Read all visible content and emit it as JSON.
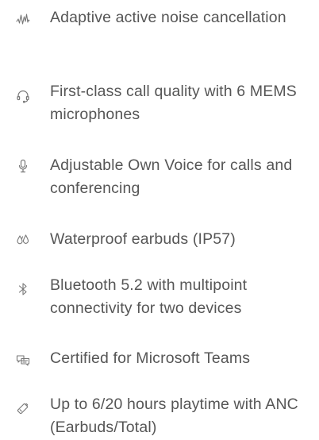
{
  "features": [
    {
      "icon": "noise-cancellation-waveform-icon",
      "text": "Adaptive active noise cancellation"
    },
    {
      "icon": "headset-icon",
      "text": "First-class call quality with 6 MEMS microphones"
    },
    {
      "icon": "microphone-icon",
      "text": "Adjustable Own Voice for calls and conferencing"
    },
    {
      "icon": "water-drops-icon",
      "text": "Waterproof earbuds (IP57)"
    },
    {
      "icon": "bluetooth-icon",
      "text": "Bluetooth 5.2 with multipoint connectivity for two devices"
    },
    {
      "icon": "chat-bubbles-icon",
      "text": "Certified for Microsoft Teams"
    },
    {
      "icon": "battery-icon",
      "text": "Up to 6/20 hours playtime with ANC (Earbuds/Total)"
    }
  ],
  "colors": {
    "text": "#565656",
    "icon": "#777777",
    "background": "#ffffff"
  }
}
